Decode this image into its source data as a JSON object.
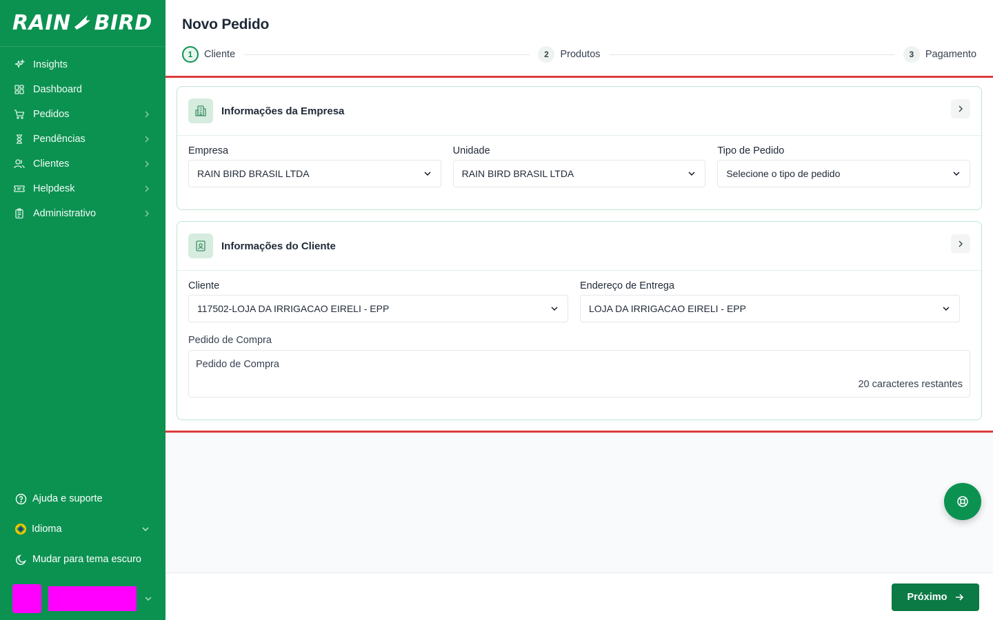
{
  "brand": {
    "logo_left": "RAIN",
    "logo_right": "BIRD"
  },
  "sidebar": {
    "items": [
      {
        "label": "Insights",
        "icon": "sparkles-icon",
        "has_chevron": false
      },
      {
        "label": "Dashboard",
        "icon": "dashboard-grid-icon",
        "has_chevron": false
      },
      {
        "label": "Pedidos",
        "icon": "cart-icon",
        "has_chevron": true
      },
      {
        "label": "Pendências",
        "icon": "hourglass-icon",
        "has_chevron": true
      },
      {
        "label": "Clientes",
        "icon": "users-icon",
        "has_chevron": true
      },
      {
        "label": "Helpdesk",
        "icon": "ticket-icon",
        "has_chevron": true
      },
      {
        "label": "Administrativo",
        "icon": "clipboard-icon",
        "has_chevron": true
      }
    ],
    "bottom": {
      "help": "Ajuda e suporte",
      "language": "Idioma",
      "theme": "Mudar para tema escuro"
    }
  },
  "header": {
    "title": "Novo Pedido",
    "steps": [
      {
        "num": "1",
        "label": "Cliente",
        "active": true
      },
      {
        "num": "2",
        "label": "Produtos",
        "active": false
      },
      {
        "num": "3",
        "label": "Pagamento",
        "active": false
      }
    ]
  },
  "company_card": {
    "title": "Informações da Empresa",
    "fields": {
      "empresa": {
        "label": "Empresa",
        "value": "RAIN BIRD BRASIL LTDA"
      },
      "unidade": {
        "label": "Unidade",
        "value": "RAIN BIRD BRASIL LTDA"
      },
      "tipo": {
        "label": "Tipo de Pedido",
        "value": "Selecione o tipo de pedido"
      }
    }
  },
  "client_card": {
    "title": "Informações do Cliente",
    "fields": {
      "cliente": {
        "label": "Cliente",
        "value": "117502-LOJA DA IRRIGACAO EIRELI - EPP"
      },
      "endereco": {
        "label": "Endereço de Entrega",
        "value": "LOJA DA IRRIGACAO EIRELI - EPP"
      },
      "pedido_compra": {
        "label": "Pedido de Compra",
        "placeholder": "Pedido de Compra",
        "counter": "20 caracteres restantes"
      }
    }
  },
  "footer": {
    "next_label": "Próximo"
  },
  "colors": {
    "brand_green": "#0b9251",
    "button_green": "#0b7a44",
    "highlight_red": "#dc3b3b"
  }
}
